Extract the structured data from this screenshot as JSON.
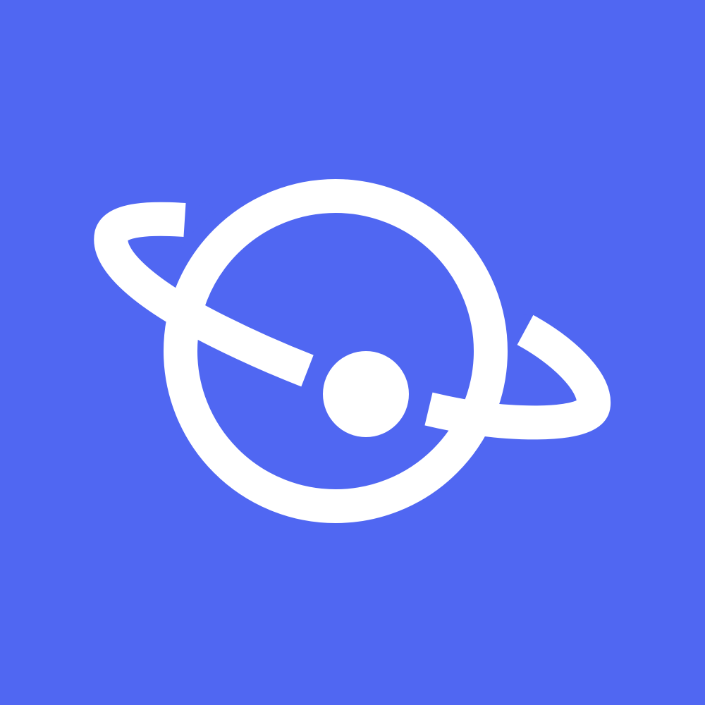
{
  "logo": {
    "icon": "planet-orbit-icon",
    "colors": {
      "background": "#5067F2",
      "foreground": "#FFFFFF"
    }
  }
}
